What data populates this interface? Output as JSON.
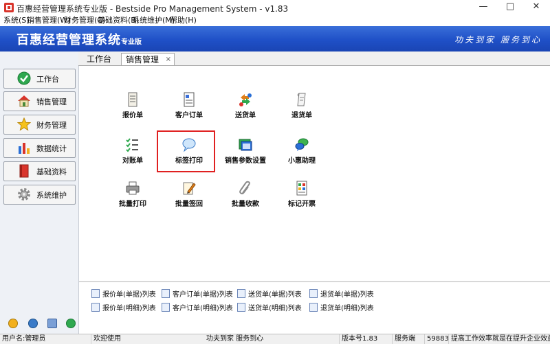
{
  "window": {
    "title": "百惠经营管理系统专业版 - Bestside Pro Management System - v1.83"
  },
  "menu": [
    "系统(S)",
    "销售管理(W)",
    "财务管理(C)",
    "基础资料(B)",
    "系统维护(M)",
    "帮助(H)"
  ],
  "banner": {
    "brand": "百惠经营管理系统",
    "brand_sub": "专业版",
    "slogan": "功夫到家  服务到心"
  },
  "sidebar": {
    "items": [
      {
        "label": "工作台",
        "icon": "checkmark-circle-icon"
      },
      {
        "label": "销售管理",
        "icon": "house-icon"
      },
      {
        "label": "财务管理",
        "icon": "star-icon"
      },
      {
        "label": "数据统计",
        "icon": "bar-chart-icon"
      },
      {
        "label": "基础资料",
        "icon": "red-book-icon"
      },
      {
        "label": "系统维护",
        "icon": "gear-icon"
      }
    ]
  },
  "tabs": {
    "workbench": "工作台",
    "sales": "销售管理",
    "close_glyph": "×"
  },
  "modules": [
    {
      "label": "报价单",
      "icon": "quote-doc-icon"
    },
    {
      "label": "客户订单",
      "icon": "customer-order-icon"
    },
    {
      "label": "送货单",
      "icon": "delivery-icon"
    },
    {
      "label": "退货单",
      "icon": "return-icon"
    },
    {
      "label": "对账单",
      "icon": "checklist-icon"
    },
    {
      "label": "标签打印",
      "icon": "speech-bubble-icon"
    },
    {
      "label": "销售参数设置",
      "icon": "settings-window-icon"
    },
    {
      "label": "小惠助理",
      "icon": "chat-assistant-icon"
    },
    {
      "label": "批量打印",
      "icon": "printer-icon"
    },
    {
      "label": "批量签回",
      "icon": "pen-sign-icon"
    },
    {
      "label": "批量收款",
      "icon": "paperclip-icon"
    },
    {
      "label": "标记开票",
      "icon": "invoice-mark-icon"
    }
  ],
  "quick_links": [
    {
      "label": "报价单(单据)列表"
    },
    {
      "label": "客户订单(单据)列表"
    },
    {
      "label": "送货单(单据)列表"
    },
    {
      "label": "退货单(单据)列表"
    },
    {
      "label": "报价单(明细)列表"
    },
    {
      "label": "客户订单(明细)列表"
    },
    {
      "label": "送货单(明细)列表"
    },
    {
      "label": "退货单(明细)列表"
    }
  ],
  "status": {
    "user": "用户名:管理员",
    "welcome": "欢迎使用",
    "motto": "功夫到家 服务到心",
    "version": "版本号1.83",
    "server_label": "服务端",
    "server_port": "59883",
    "tagline": "提高工作效率就是在提升企业效益"
  },
  "colors": {
    "banner": "#1f50c7",
    "highlight": "#e02020"
  }
}
